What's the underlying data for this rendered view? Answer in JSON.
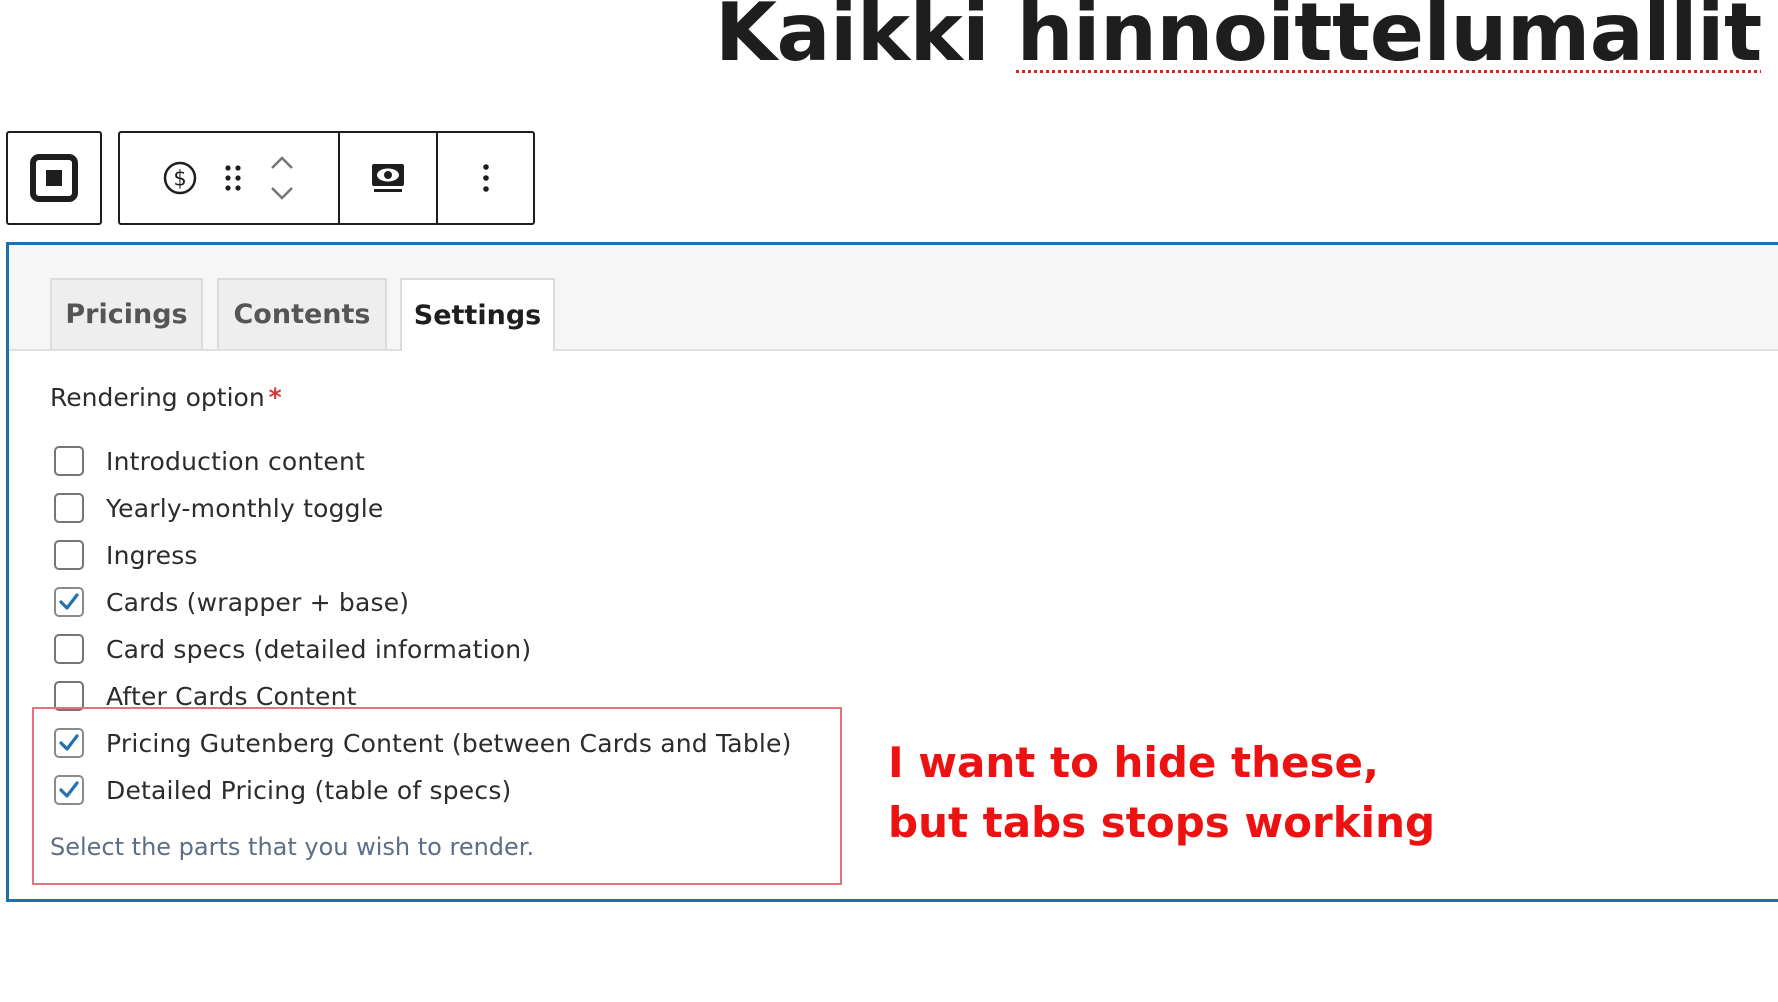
{
  "page": {
    "title_part1": "Kaikki ",
    "title_part2": "hinnoittelumallit"
  },
  "toolbar": {
    "block_type_icon": "block-square-icon",
    "block_icon": "dollar-circle-icon",
    "drag_icon": "drag-handle-icon",
    "move_up_icon": "chevron-up-icon",
    "move_down_icon": "chevron-down-icon",
    "preview_icon": "preview-eye-icon",
    "options_icon": "more-vertical-icon"
  },
  "tabs": [
    {
      "label": "Pricings",
      "active": false
    },
    {
      "label": "Contents",
      "active": false
    },
    {
      "label": "Settings",
      "active": true
    }
  ],
  "settings": {
    "field_label": "Rendering option",
    "required_marker": "*",
    "options": [
      {
        "label": "Introduction content",
        "checked": false
      },
      {
        "label": "Yearly-monthly toggle",
        "checked": false
      },
      {
        "label": "Ingress",
        "checked": false
      },
      {
        "label": "Cards (wrapper + base)",
        "checked": true
      },
      {
        "label": "Card specs (detailed information)",
        "checked": false
      },
      {
        "label": "After Cards Content",
        "checked": false
      },
      {
        "label": "Pricing Gutenberg Content (between Cards and Table)",
        "checked": true
      },
      {
        "label": "Detailed Pricing (table of specs)",
        "checked": true
      }
    ],
    "help_text": "Select the parts that you wish to render."
  },
  "annotation": {
    "line1": "I want to hide these,",
    "line2": "but tabs stops working"
  },
  "colors": {
    "frame_border": "#1e6fae",
    "check_color": "#2271b1",
    "annotation_red": "#ee1111",
    "annotation_box": "#e8707a",
    "required_red": "#d63638"
  }
}
